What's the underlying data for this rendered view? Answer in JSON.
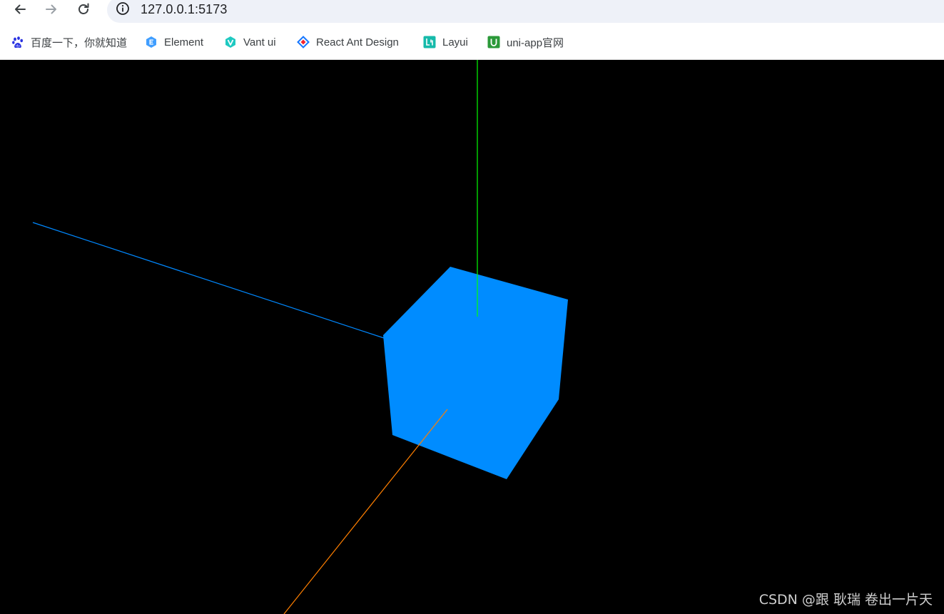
{
  "browser": {
    "url": "127.0.0.1:5173",
    "nav": {
      "back_icon": "arrow-left-icon",
      "forward_icon": "arrow-right-icon",
      "reload_icon": "reload-icon",
      "site_info_icon": "info-circle-icon"
    }
  },
  "bookmarks": [
    {
      "label": "百度一下，你就知道",
      "icon": "baidu-paw-icon",
      "color": "#2932e1"
    },
    {
      "label": "Element",
      "icon": "element-logo-icon",
      "color": "#409eff"
    },
    {
      "label": "Vant ui",
      "icon": "vant-logo-icon",
      "color": "#1fc9c1"
    },
    {
      "label": "React Ant Design",
      "icon": "antd-logo-icon",
      "color": "#1677ff"
    },
    {
      "label": "Layui",
      "icon": "layui-logo-icon",
      "color": "#16baaa"
    },
    {
      "label": "uni-app官网",
      "icon": "uniapp-logo-icon",
      "color": "#2b9939"
    }
  ],
  "scene": {
    "background": "#000000",
    "cube_color": "#008cff",
    "axes": {
      "x_color": "#ff7f00",
      "y_color": "#00ff00",
      "z_color": "#0088ff"
    }
  },
  "watermark": "CSDN @跟 耿瑞 卷出一片天"
}
